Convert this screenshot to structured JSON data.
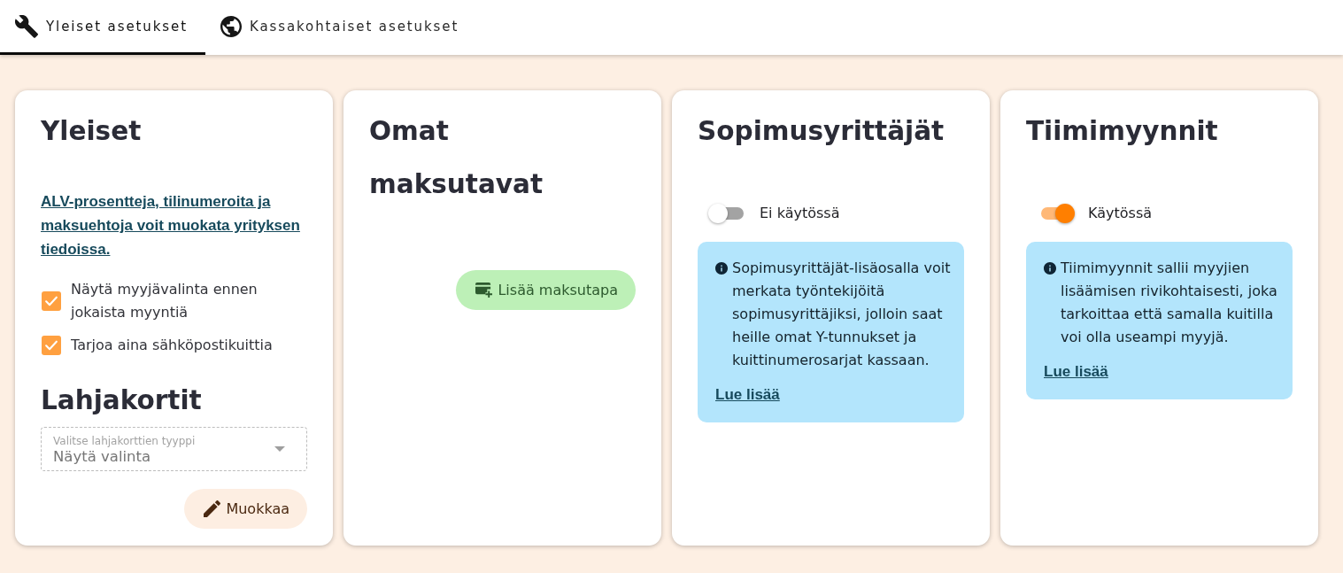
{
  "tabs": [
    {
      "label": "Yleiset asetukset",
      "selected": true
    },
    {
      "label": "Kassakohtaiset asetukset",
      "selected": false
    }
  ],
  "cards": [
    {
      "kind": "general",
      "title": "Yleiset",
      "link": "ALV-prosentteja, tilinumeroita ja maksuehtoja voit muokata yrityksen tiedoissa.",
      "checkboxes": [
        {
          "label": "Näytä myyjävalinta ennen jokaista myyntiä",
          "checked": true
        },
        {
          "label": "Tarjoa aina sähköpostikuittia",
          "checked": true
        }
      ],
      "subtitle": "Lahjakortit",
      "select": {
        "label": "Valitse lahjakorttien tyyppi",
        "value": "Näytä valinta",
        "disabled": true
      },
      "button": "Muokkaa"
    },
    {
      "kind": "payments",
      "title": "Omat maksutavat",
      "button": "Lisää maksutapa"
    },
    {
      "kind": "feature",
      "title": "Sopimusyrittäjät",
      "toggle": {
        "on": false,
        "label": "Ei käytössä"
      },
      "info": "Sopimusyrittäjät-lisäosalla voit merkata työntekijöitä sopimusyrittäjiksi, jolloin saat heille omat Y-tunnukset ja kuittinumerosarjat kassaan.",
      "link": "Lue lisää"
    },
    {
      "kind": "feature",
      "title": "Tiimimyynnit",
      "toggle": {
        "on": true,
        "label": "Käytössä"
      },
      "info": "Tiimimyynnit sallii myyjien lisäämisen rivikohtaisesti, joka tarkoittaa että samalla kuitilla voi olla useampi myyjä.",
      "link": "Lue lisää"
    }
  ]
}
